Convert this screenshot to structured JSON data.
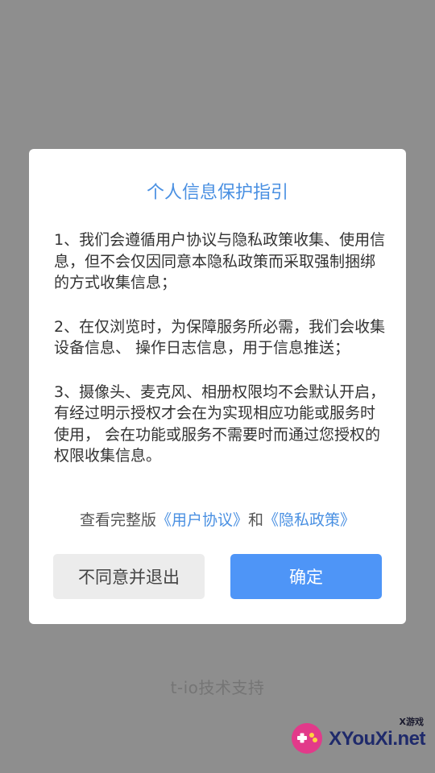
{
  "dialog": {
    "title": "个人信息保护指引",
    "paragraphs": [
      "1、我们会遵循用户协议与隐私政策收集、使用信息，但不会仅因同意本隐私政策而采取强制捆绑的方式收集信息；",
      "2、在仅浏览时，为保障服务所必需，我们会收集设备信息、 操作日志信息，用于信息推送；",
      "3、摄像头、麦克风、相册权限均不会默认开启， 有经过明示授权才会在为实现相应功能或服务时使用， 会在功能或服务不需要时而通过您授权的权限收集信息。"
    ],
    "links_prefix": "查看完整版",
    "user_agreement_link": "《用户协议》",
    "links_conjunction": "和",
    "privacy_policy_link": "《隐私政策》",
    "disagree_button": "不同意并退出",
    "confirm_button": "确定"
  },
  "footer": {
    "support_text": "t-io技术支持"
  },
  "watermark": {
    "small_text": "X游戏",
    "main_text": "XYouXi.net"
  },
  "colors": {
    "accent": "#4a90e2",
    "confirm_bg": "#4e95f7",
    "disagree_bg": "#ececec",
    "overlay": "#8e8e8e"
  }
}
